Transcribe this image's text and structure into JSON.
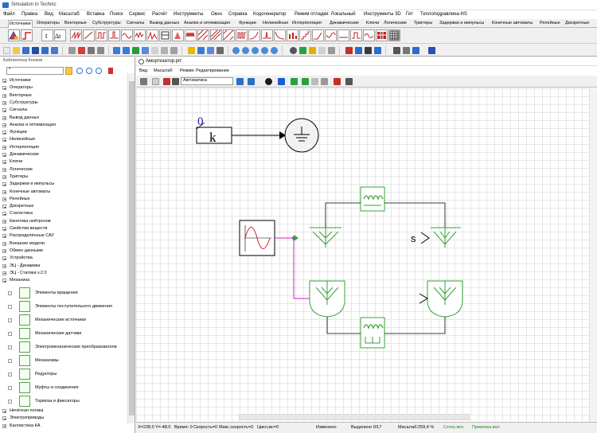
{
  "window": {
    "title": "Simulation In Technic"
  },
  "menu": [
    "Файл",
    "Правка",
    "Вид",
    "Масштаб",
    "Вставка",
    "Поиск",
    "Сервис",
    "Расчёт",
    "Инструменты",
    "Окно",
    "Справка",
    "Кодогенератор",
    "Режим отладки: Локальный",
    "Инструменты 3D",
    "Гит",
    "Теплогидравлика-HS"
  ],
  "palette_tabs": [
    "Источники",
    "Операторы",
    "Векторные",
    "Субструктуры",
    "Сигналы",
    "Вывод данных",
    "Анализ и оптимизация",
    "Функции",
    "Нелинейные",
    "Интерполяция",
    "Динамические",
    "Ключи",
    "Логические",
    "Триггеры",
    "Задержки и импульсы",
    "Конечные автоматы",
    "Релейные",
    "Дискретные"
  ],
  "palette_glyphs": {
    "text_t": "t",
    "delta_t": "Δt"
  },
  "library": {
    "header": "Библиотека блоков",
    "search_value": "*",
    "categories": [
      "Источники",
      "Операторы",
      "Векторные",
      "Субструктуры",
      "Сигналы",
      "Вывод данных",
      "Анализ и оптимизация",
      "Функции",
      "Нелинейные",
      "Интерполяция",
      "Динамические",
      "Ключи",
      "Логические",
      "Триггеры",
      "Задержки и импульсы",
      "Конечные автоматы",
      "Релейные",
      "Дискретные",
      "Статистика",
      "Кинетика нейтронов",
      "Свойства веществ",
      "Распределённые САУ",
      "Внешние модели",
      "Обмен данными",
      "Устройства",
      "ЭЦ - Динамика",
      "ЭЦ - Статика v.2.0",
      "Механика"
    ],
    "mechanics_items": [
      "Элементы вращения",
      "Элементы поступательного движения",
      "Механические источники",
      "Механические датчики",
      "Электромеханические преобразователи",
      "Механизмы",
      "Редукторы",
      "Муфты и соединения",
      "Тормоза и фиксаторы"
    ],
    "after": [
      "Нечёткая логика",
      "Электроприводы",
      "Баллистика КА"
    ]
  },
  "document": {
    "title": "Амортизатор.prt",
    "menu": [
      "Вид",
      "Масштаб",
      "Режим: Редактирование"
    ],
    "mode_value": "Автоматика"
  },
  "diagram": {
    "gain_value": "0",
    "gain_symbol": "k",
    "label_s": "s"
  },
  "status": {
    "coords": "X=228.0  Y=-48.0",
    "time": "Время: 0",
    "speed": "Скорость=0",
    "maxspeed": "Макс.скорость=0",
    "cycle": "Цикл,мс=0",
    "changed": "Изменено",
    "selected": "Выделено 0/17",
    "scale": "Масштаб:259,4 %",
    "grid": "Сетка вкл.",
    "snap": "Привязка вкл."
  },
  "colors": {
    "block_green": "#36a336",
    "signal_magenta": "#d020c0",
    "status_green": "#1e8c1e"
  }
}
